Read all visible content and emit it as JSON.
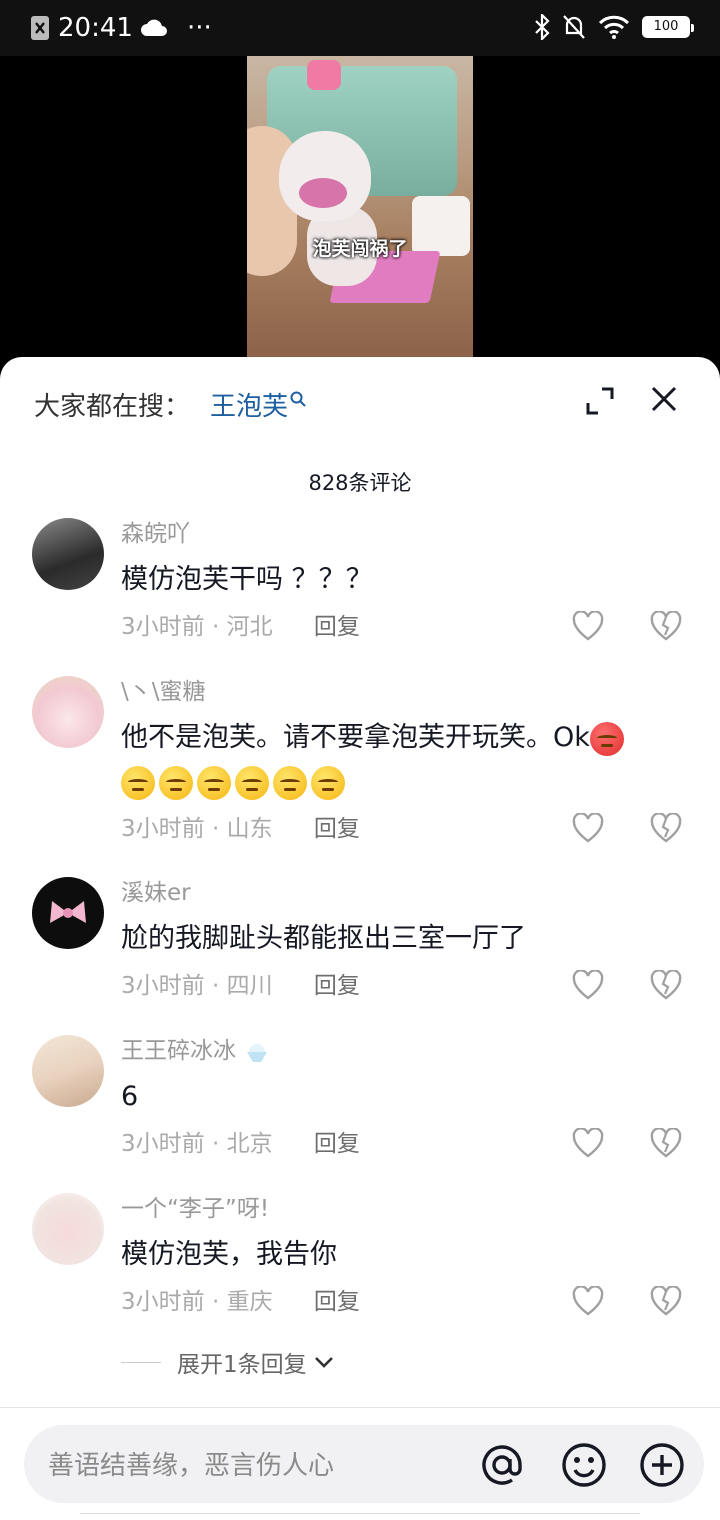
{
  "status_bar": {
    "time": "20:41",
    "menu_dots": "···",
    "battery": "100"
  },
  "video": {
    "caption": "泡芙闯祸了"
  },
  "header": {
    "hot_search_label": "大家都在搜：",
    "hot_search_term": "王泡芙"
  },
  "comment_count": "828条评论",
  "comments": [
    {
      "user": "森皖吖",
      "text": "模仿泡芙干吗 ？？？",
      "time": "3小时前",
      "location": "河北",
      "reply": "回复"
    },
    {
      "user": "\\丶\\蜜糖",
      "text": "他不是泡芙。请不要拿泡芙开玩笑。Ok",
      "time": "3小时前",
      "location": "山东",
      "reply": "回复"
    },
    {
      "user": "溪妹er",
      "text": "尬的我脚趾头都能抠出三室一厅了",
      "time": "3小时前",
      "location": "四川",
      "reply": "回复"
    },
    {
      "user": "王王碎冰冰",
      "text": "6",
      "time": "3小时前",
      "location": "北京",
      "reply": "回复"
    },
    {
      "user": "一个“李子”呀!",
      "text": "模仿泡芙，我告你",
      "time": "3小时前",
      "location": "重庆",
      "reply": "回复"
    }
  ],
  "expand_replies": "展开1条回复",
  "input": {
    "placeholder": "善语结善缘，恶言伤人心"
  },
  "icons": {
    "expand": "expand-icon",
    "close": "close-icon",
    "like": "heart-icon",
    "dislike": "broken-heart-icon",
    "at": "at-icon",
    "emoji": "smiley-icon",
    "add": "plus-circle-icon"
  },
  "colors": {
    "accent_link": "#1f5fa0",
    "text_primary": "#161823",
    "text_secondary": "#999999"
  }
}
